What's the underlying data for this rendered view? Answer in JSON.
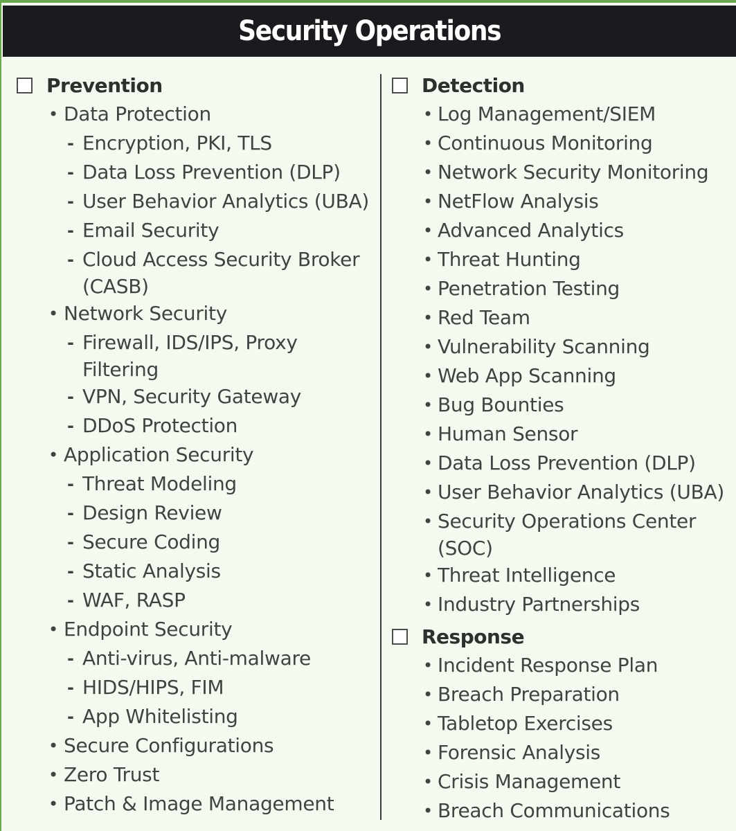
{
  "title": "Security Operations",
  "markers": {
    "bullet": "•",
    "dash": "-"
  },
  "prevention": {
    "heading": "Prevention",
    "items": [
      {
        "level": 1,
        "text": "Data Protection"
      },
      {
        "level": 2,
        "text": "Encryption, PKI, TLS"
      },
      {
        "level": 2,
        "text": "Data Loss Prevention (DLP)"
      },
      {
        "level": 2,
        "text": "User Behavior Analytics (UBA)"
      },
      {
        "level": 2,
        "text": "Email Security"
      },
      {
        "level": 2,
        "text": "Cloud Access Security Broker",
        "cont": "(CASB)"
      },
      {
        "level": 1,
        "text": "Network Security"
      },
      {
        "level": 2,
        "text": "Firewall, IDS/IPS, Proxy",
        "cont": "Filtering"
      },
      {
        "level": 2,
        "text": "VPN, Security Gateway"
      },
      {
        "level": 2,
        "text": "DDoS Protection"
      },
      {
        "level": 1,
        "text": "Application Security"
      },
      {
        "level": 2,
        "text": "Threat Modeling"
      },
      {
        "level": 2,
        "text": "Design Review"
      },
      {
        "level": 2,
        "text": "Secure Coding"
      },
      {
        "level": 2,
        "text": "Static Analysis"
      },
      {
        "level": 2,
        "text": "WAF, RASP"
      },
      {
        "level": 1,
        "text": "Endpoint Security"
      },
      {
        "level": 2,
        "text": "Anti-virus, Anti-malware"
      },
      {
        "level": 2,
        "text": "HIDS/HIPS, FIM"
      },
      {
        "level": 2,
        "text": "App Whitelisting"
      },
      {
        "level": 1,
        "text": "Secure Configurations"
      },
      {
        "level": 1,
        "text": "Zero Trust"
      },
      {
        "level": 1,
        "text": "Patch & Image Management"
      }
    ]
  },
  "detection": {
    "heading": "Detection",
    "items": [
      {
        "level": 1,
        "text": "Log Management/SIEM"
      },
      {
        "level": 1,
        "text": "Continuous Monitoring"
      },
      {
        "level": 1,
        "text": "Network Security Monitoring"
      },
      {
        "level": 1,
        "text": "NetFlow Analysis"
      },
      {
        "level": 1,
        "text": "Advanced Analytics"
      },
      {
        "level": 1,
        "text": "Threat Hunting"
      },
      {
        "level": 1,
        "text": "Penetration Testing"
      },
      {
        "level": 1,
        "text": "Red Team"
      },
      {
        "level": 1,
        "text": "Vulnerability Scanning"
      },
      {
        "level": 1,
        "text": "Web App Scanning"
      },
      {
        "level": 1,
        "text": "Bug Bounties"
      },
      {
        "level": 1,
        "text": "Human Sensor"
      },
      {
        "level": 1,
        "text": "Data Loss Prevention (DLP)"
      },
      {
        "level": 1,
        "text": "User Behavior Analytics (UBA)"
      },
      {
        "level": 1,
        "text": "Security Operations Center",
        "cont": "(SOC)"
      },
      {
        "level": 1,
        "text": "Threat Intelligence"
      },
      {
        "level": 1,
        "text": "Industry Partnerships"
      }
    ]
  },
  "response": {
    "heading": "Response",
    "items": [
      {
        "level": 1,
        "text": "Incident Response Plan"
      },
      {
        "level": 1,
        "text": "Breach Preparation"
      },
      {
        "level": 1,
        "text": "Tabletop Exercises"
      },
      {
        "level": 1,
        "text": "Forensic Analysis"
      },
      {
        "level": 1,
        "text": "Crisis Management"
      },
      {
        "level": 1,
        "text": "Breach Communications"
      }
    ]
  }
}
